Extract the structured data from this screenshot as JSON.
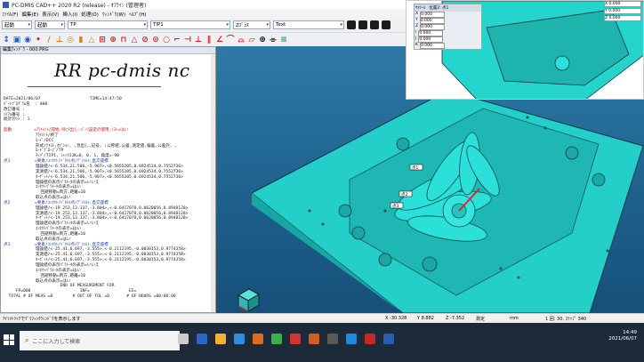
{
  "window": {
    "title": "PC-DMIS CAD++ 2020 R2 (release) - ｵﾌﾗｲﾝ (管理者)"
  },
  "menu": [
    "ﾌｧｲﾙ(F)",
    "編集(E)",
    "表示(V)",
    "挿入(I)",
    "処理(O)",
    "ｳｨﾝﾄﾞｳ(W)",
    "ﾍﾙﾌﾟ(H)"
  ],
  "toolbar": {
    "combos": [
      {
        "label": "起動"
      },
      {
        "label": "起動"
      },
      {
        "label": "TP"
      },
      {
        "label": "TIP1"
      },
      {
        "label": "Zﾌﾟﾗｽ"
      },
      {
        "label": "Text"
      }
    ]
  },
  "editor": {
    "title": "編集ｳｨﾝﾄﾞｳ - 000.PRG",
    "logo_text": "RR pc-dmis nc",
    "lines": [
      {
        "t": "DATE=2021/06/07                    TIME=14:47:50",
        "c": ""
      },
      {
        "t": "ﾊﾟｰﾄﾌﾟﾛｸﾞﾗﾑ名  : 000",
        "c": ""
      },
      {
        "t": "改訂番号 :",
        "c": ""
      },
      {
        "t": "ｼﾘｱﾙ番号 :",
        "c": ""
      },
      {
        "t": "統計ｶｳﾝﾄ : 1",
        "c": ""
      },
      {
        "t": "",
        "c": ""
      },
      {
        "t": "起動         =ｱﾗｲﾒﾝﾄ/開始,呼び出し:ﾊﾟｰﾂ設定の使用,ﾘｽﾄ=はい",
        "c": "r"
      },
      {
        "t": "             ｱﾗｲﾒﾝﾄ/終了",
        "c": ""
      },
      {
        "t": "             ﾓｰﾄﾞ/DCC",
        "c": ""
      },
      {
        "t": "             形式/ﾃｷｽﾄ,ｵﾌﾟｼｮﾝ, ,見出し,記号, ;公称値,公差,測定値,偏差,公差外, ,",
        "c": ""
      },
      {
        "t": "             ﾛｰﾄﾞﾌﾟﾛｰﾌﾞ/TP",
        "c": ""
      },
      {
        "t": "             ﾁｯﾌﾟ/TIP1, ｼｬﾝｸIJK=0, 0, 1, 角度=-90",
        "c": ""
      },
      {
        "t": "点1          =要素/ｺﾝﾀｸﾄ/ﾍﾞｸﾄﾙ点/ﾃﾞﾌｫﾙﾄ,直交座標",
        "c": "b"
      },
      {
        "t": "             理論値/<-6.534,21.506,-5.907>,<0.5655205,0.6924534,0.7552736>",
        "c": ""
      },
      {
        "t": "             実測値/<-6.534,21.506,-5.907>,<0.5655205,0.6924534,0.7552736>",
        "c": ""
      },
      {
        "t": "             ﾀｰｹﾞｯﾄ/<-6.534,21.506,-5.907>,<0.5655205,0.6924534,0.7552736>",
        "c": ""
      },
      {
        "t": "             理論値の表示ﾊﾟﾗﾒｰﾀの表示=いいえ",
        "c": ""
      },
      {
        "t": "             ｺﾝﾀｸﾄﾊﾟﾗﾒｰﾀの表示=はい",
        "c": ""
      },
      {
        "t": "               回避移動=両方,距離=10",
        "c": ""
      },
      {
        "t": "             取込点の表示=はい",
        "c": ""
      },
      {
        "t": "点2          =要素/ｺﾝﾀｸﾄ/ﾍﾞｸﾄﾙ点/ﾃﾞﾌｫﾙﾄ,直交座標",
        "c": "b"
      },
      {
        "t": "             理論値/<-19.253,13.137,-3.804>,<-0.6417078,0.0620056,0.8948128>",
        "c": ""
      },
      {
        "t": "             実測値/<-19.253,13.137,-3.804>,<-0.6417078,0.0620056,0.8948128>",
        "c": ""
      },
      {
        "t": "             ﾀｰｹﾞｯﾄ/<-19.253,13.137,-3.804>,<-0.6417078,0.0620056,0.8948128>",
        "c": ""
      },
      {
        "t": "             理論値の表示ﾊﾟﾗﾒｰﾀの表示=いいえ",
        "c": ""
      },
      {
        "t": "             ｺﾝﾀｸﾄﾊﾟﾗﾒｰﾀの表示=はい",
        "c": ""
      },
      {
        "t": "               回避移動=両方,距離=10",
        "c": ""
      },
      {
        "t": "             取込点の表示=はい",
        "c": ""
      },
      {
        "t": "点3          =要素/ｺﾝﾀｸﾄ/ﾍﾞｸﾄﾙ点/ﾃﾞﾌｫﾙﾄ,直交座標",
        "c": "b"
      },
      {
        "t": "             理論値/<-25.41,6.697,-3.555>,<-0.2112195,-0.0030153,0.9774358>",
        "c": ""
      },
      {
        "t": "             実測値/<-25.41,6.697,-3.555>,<-0.2112195,-0.0030153,0.9774358>",
        "c": ""
      },
      {
        "t": "             ﾀｰｹﾞｯﾄ/<-25.41,6.697,-3.555>,<-0.2112195,-0.0030153,0.9774358>",
        "c": ""
      },
      {
        "t": "             理論値の表示ﾊﾟﾗﾒｰﾀの表示=いいえ",
        "c": ""
      },
      {
        "t": "             ｺﾝﾀｸﾄﾊﾟﾗﾒｰﾀの表示=はい",
        "c": ""
      },
      {
        "t": "               回避移動=両方,距離=10",
        "c": ""
      },
      {
        "t": "             取込点の表示=はい",
        "c": ""
      },
      {
        "t": "                       END OF MEASUREMENT FOR",
        "c": ""
      },
      {
        "t": "     FP=000                    INF=                EE=",
        "c": ""
      },
      {
        "t": "  TOTAL # OF MEAS =0        # OUT OF TOL =0       # OF HOURS =00:00:00",
        "c": ""
      }
    ]
  },
  "viewport": {
    "labels": [
      "点1",
      "点2",
      "点3"
    ]
  },
  "inset": {
    "header_left": "ｻﾏﾘｰﾙ",
    "header_mid": "位置2: 点1",
    "fields": [
      "0.000",
      "0.000",
      "0.000",
      "0.000",
      "0.000",
      "0.000"
    ],
    "right_fields": [
      "X 0.000",
      "Y 0.000",
      "Z 0.000"
    ]
  },
  "status": {
    "message": "ｱｲｿﾒﾄﾘｯｸでｸﾞﾗﾌｨｯｸｳｨﾝﾄﾞｳを表示します",
    "x": "X -30.328",
    "y": "Y 8.882",
    "z": "Z -7.352",
    "mode": "測定",
    "mm": "mm",
    "stats": "1 回: 30, ｽﾃｯﾌﾟ 340"
  },
  "taskbar": {
    "search_placeholder": "ここに入力して検索",
    "time": "14:49",
    "date": "2021/06/07"
  }
}
